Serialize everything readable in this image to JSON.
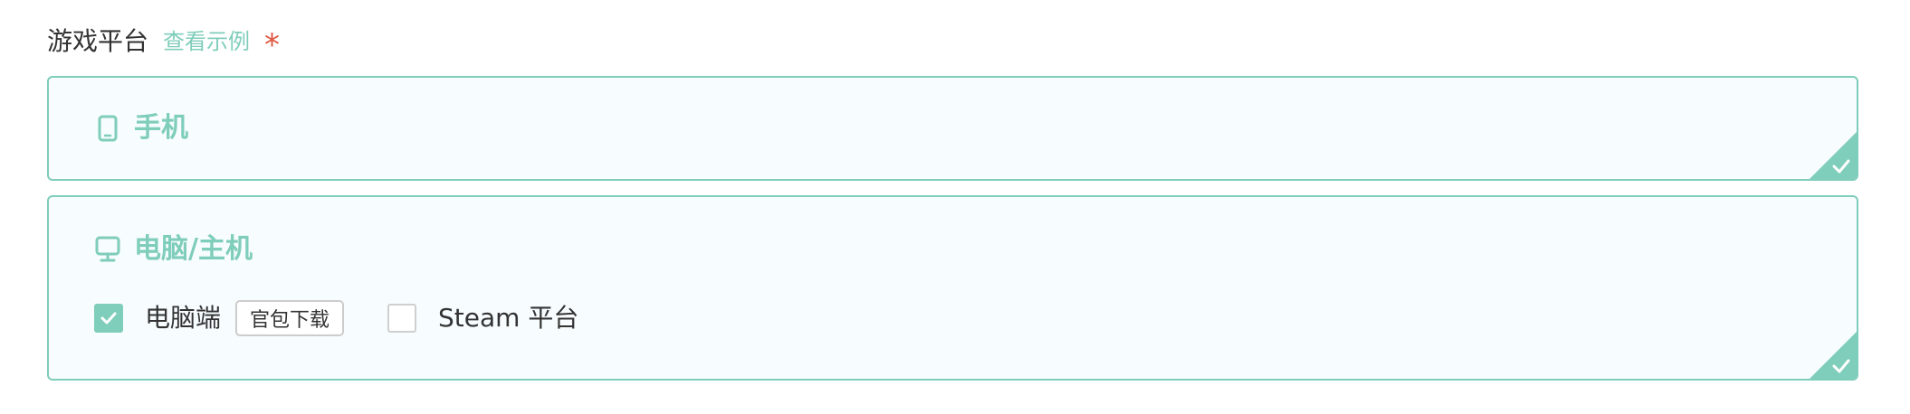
{
  "field": {
    "label": "游戏平台",
    "example_link": "查看示例",
    "required_mark": "*"
  },
  "platforms": {
    "mobile": {
      "title": "手机",
      "icon": "mobile-phone-icon",
      "selected": true
    },
    "pc": {
      "title": "电脑/主机",
      "icon": "desktop-monitor-icon",
      "selected": true,
      "options": {
        "pc_client": {
          "label": "电脑端",
          "checked": true,
          "download_button": "官包下载"
        },
        "steam": {
          "label": "Steam 平台",
          "checked": false
        }
      }
    }
  },
  "colors": {
    "accent": "#7fcdbb",
    "required": "#e0543f",
    "card_bg": "#f7fcfe",
    "text": "#333333"
  }
}
